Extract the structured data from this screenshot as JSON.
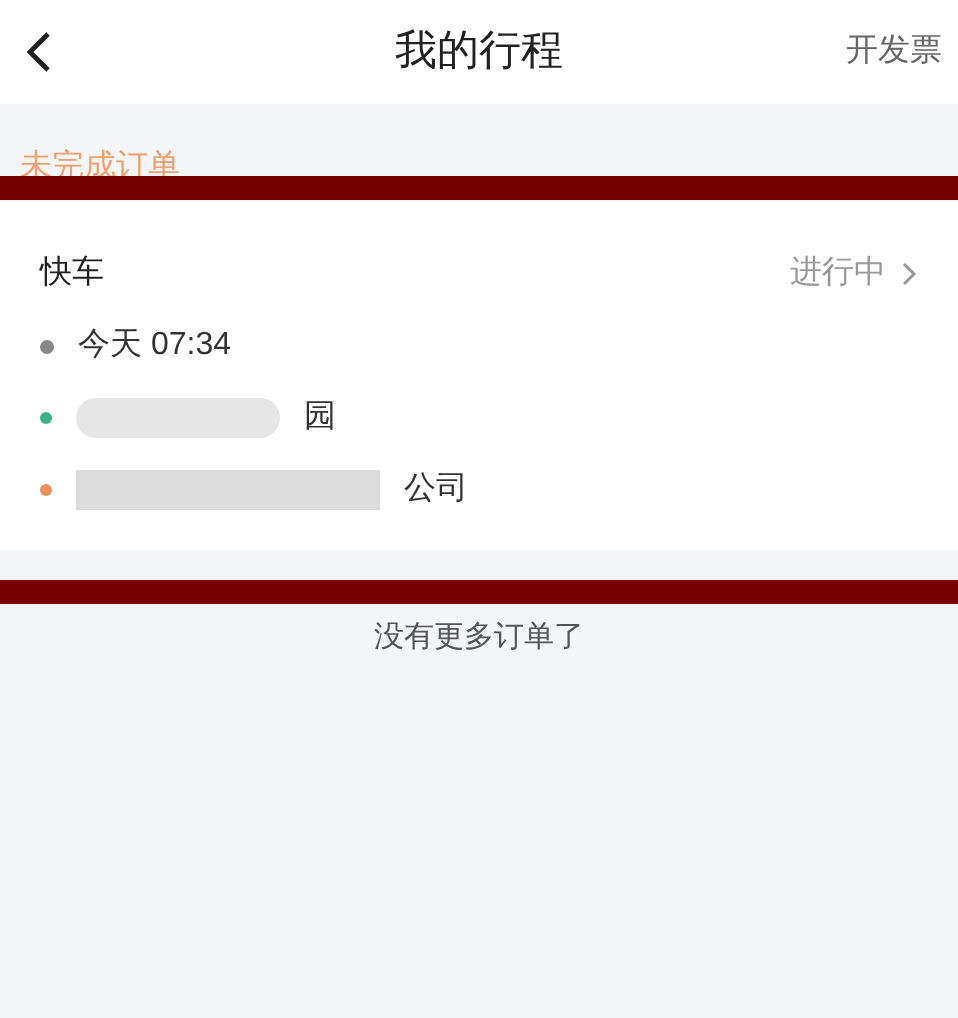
{
  "header": {
    "title": "我的行程",
    "action": "开发票"
  },
  "section_label": "未完成订单",
  "order": {
    "type": "快车",
    "status": "进行中",
    "time": "今天 07:34",
    "stops": [
      {
        "text": "园",
        "color": "#3fb08a"
      },
      {
        "text": "公司",
        "color": "#e8925a"
      }
    ]
  },
  "footer_note": "没有更多订单了"
}
